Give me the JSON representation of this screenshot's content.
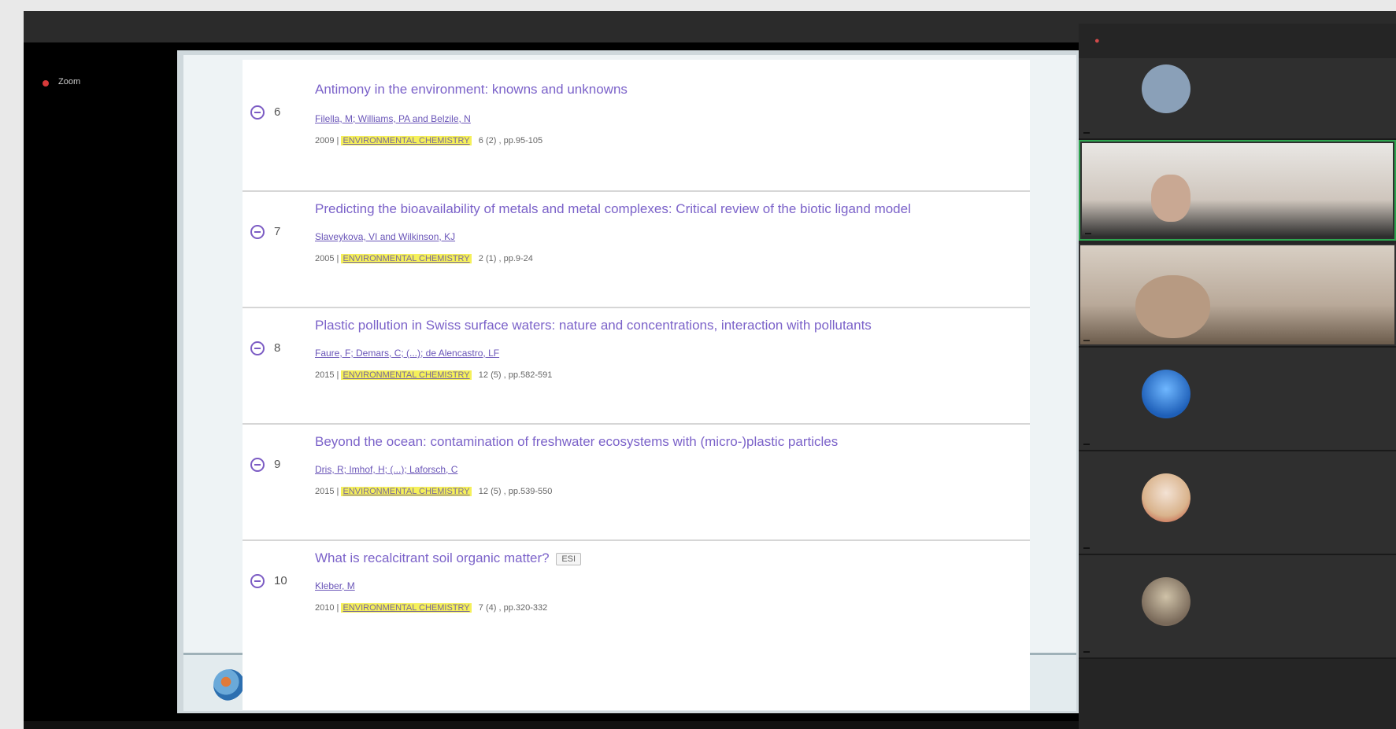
{
  "meeting": {
    "recording_label": "Zoom"
  },
  "results": [
    {
      "index": "6",
      "title": "Antimony in the environment: knowns and unknowns",
      "authors": "Filella, M; Williams, PA and Belzile, N",
      "year": "2009",
      "journal": "ENVIRONMENTAL CHEMISTRY",
      "volume": "6 (2) , pp.95-105",
      "tag": ""
    },
    {
      "index": "7",
      "title": "Predicting the bioavailability of metals and metal complexes: Critical review of the biotic ligand model",
      "authors": "Slaveykova, VI and Wilkinson, KJ",
      "year": "2005",
      "journal": "ENVIRONMENTAL CHEMISTRY",
      "volume": "2 (1) , pp.9-24",
      "tag": ""
    },
    {
      "index": "8",
      "title": "Plastic pollution in Swiss surface waters: nature and concentrations, interaction with pollutants",
      "authors": "Faure, F; Demars, C; (...); de Alencastro, LF",
      "year": "2015",
      "journal": "ENVIRONMENTAL CHEMISTRY",
      "volume": "12 (5) , pp.582-591",
      "tag": ""
    },
    {
      "index": "9",
      "title": "Beyond the ocean: contamination of freshwater ecosystems with (micro-)plastic particles",
      "authors": "Dris, R; Imhof, H; (...); Laforsch, C",
      "year": "2015",
      "journal": "ENVIRONMENTAL CHEMISTRY",
      "volume": "12 (5) , pp.539-550",
      "tag": ""
    },
    {
      "index": "10",
      "title": "What is recalcitrant soil organic matter?",
      "authors": "Kleber, M",
      "year": "2010",
      "journal": "ENVIRONMENTAL CHEMISTRY",
      "volume": "7 (4) , pp.320-332",
      "tag": "ESI"
    }
  ],
  "participants": {
    "header": "",
    "tiles": [
      {
        "name": "",
        "avatar_color": "#8aa0b8",
        "type": "avatar"
      },
      {
        "name": "",
        "avatar_color": "#b89a8a",
        "type": "video",
        "active": true
      },
      {
        "name": "",
        "avatar_color": "#a88e7a",
        "type": "video",
        "active": false
      },
      {
        "name": "",
        "avatar_color": "#2f7fd8",
        "type": "avatar"
      },
      {
        "name": "",
        "avatar_color": "#d9b38c",
        "type": "avatar"
      },
      {
        "name": "",
        "avatar_color": "#7a6a5a",
        "type": "avatar"
      }
    ]
  }
}
